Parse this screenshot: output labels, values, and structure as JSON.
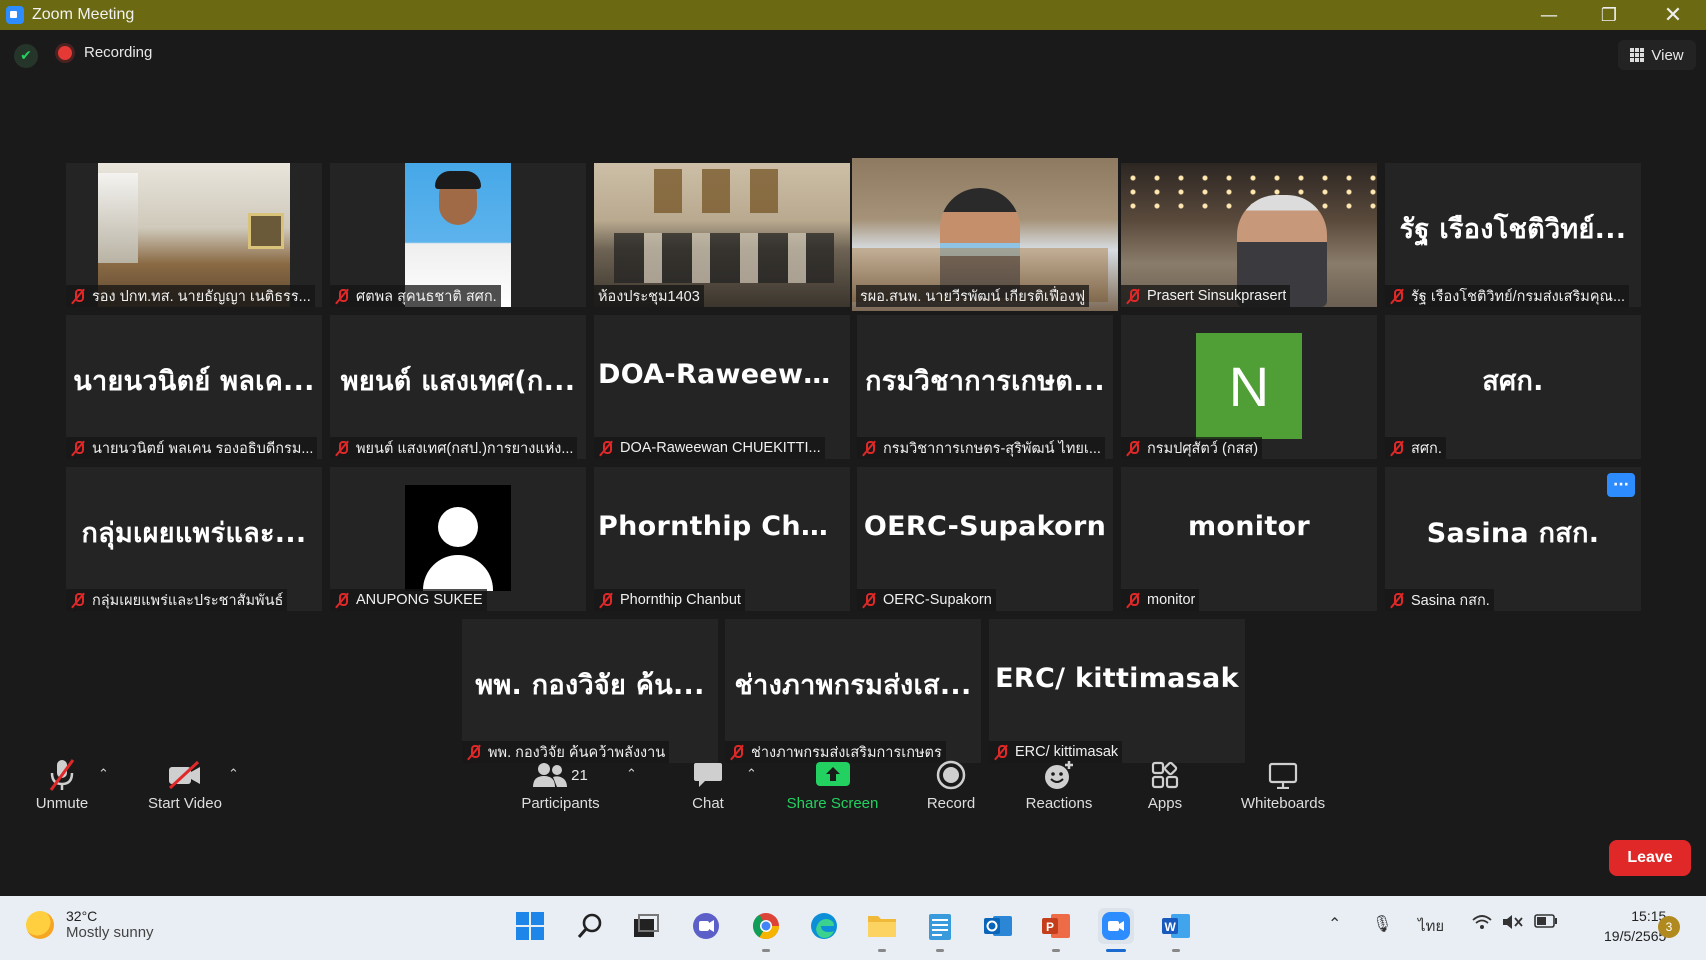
{
  "window": {
    "title": "Zoom Meeting"
  },
  "topbar": {
    "recording_label": "Recording",
    "view_label": "View"
  },
  "tiles": {
    "t1": {
      "name": "รอง ปกท.ทส. นายธัญญา เนติธรร...",
      "big": ""
    },
    "t2": {
      "name": "ศตพล สุคนธชาติ สศก.",
      "big": ""
    },
    "t3": {
      "name": "ห้องประชุม1403",
      "big": ""
    },
    "t4": {
      "name": "รผอ.สนพ. นายวีรพัฒน์ เกียรติเฟื่องฟู",
      "big": ""
    },
    "t5": {
      "name": "Prasert Sinsukprasert",
      "big": ""
    },
    "t6": {
      "name": "รัฐ เรืองโชติวิทย์/กรมส่งเสริมคุณ...",
      "big": "รัฐ  เรืองโชติวิทย์..."
    },
    "t7": {
      "name": "นายนวนิตย์ พลเคน รองอธิบดีกรม...",
      "big": "นายนวนิตย์ พลเค..."
    },
    "t8": {
      "name": "พยนต์ แสงเทศ(กสป.)การยางแห่ง...",
      "big": "พยนต์ แสงเทศ(ก..."
    },
    "t9": {
      "name": "DOA-Raweewan CHUEKITTI...",
      "big": "DOA-Raweewa..."
    },
    "t10": {
      "name": "กรมวิชาการเกษตร-สุริพัฒน์ ไทยเ...",
      "big": "กรมวิชาการเกษต..."
    },
    "t11": {
      "name": "กรมปศุสัตว์ (กสส)",
      "avatar_letter": "N",
      "avatar_color": "#4f9e36"
    },
    "t12": {
      "name": "สศก.",
      "big": "สศก."
    },
    "t13": {
      "name": "กลุ่มเผยแพร่และประชาสัมพันธ์",
      "big": "กลุ่มเผยแพร่และ..."
    },
    "t14": {
      "name": "ANUPONG SUKEE"
    },
    "t15": {
      "name": "Phornthip Chanbut",
      "big": "Phornthip  Chan..."
    },
    "t16": {
      "name": "OERC-Supakorn",
      "big": "OERC-Supakorn"
    },
    "t17": {
      "name": "monitor",
      "big": "monitor"
    },
    "t18": {
      "name": "Sasina กสก.",
      "big": "Sasina กสก."
    },
    "t19": {
      "name": "พพ. กองวิจัย ค้นคว้าพลังงาน",
      "big": "พพ. กองวิจัย ค้น..."
    },
    "t20": {
      "name": "ช่างภาพกรมส่งเสริมการเกษตร",
      "big": "ช่างภาพกรมส่งเส..."
    },
    "t21": {
      "name": "ERC/ kittimasak",
      "big": "ERC/ kittimasak"
    }
  },
  "toolbar": {
    "unmute": "Unmute",
    "start_video": "Start Video",
    "participants": "Participants",
    "participants_count": "21",
    "chat": "Chat",
    "share_screen": "Share Screen",
    "record": "Record",
    "reactions": "Reactions",
    "apps": "Apps",
    "whiteboards": "Whiteboards",
    "leave": "Leave"
  },
  "taskbar": {
    "weather_temp": "32°C",
    "weather_desc": "Mostly sunny",
    "language": "ไทย",
    "time": "15:15",
    "date": "19/5/2565",
    "notifications": "3"
  },
  "colors": {
    "accent_green": "#23d160",
    "leave_red": "#e02828",
    "active_speaker_border": "#d6e85a",
    "title_bar": "#6b6a12"
  }
}
